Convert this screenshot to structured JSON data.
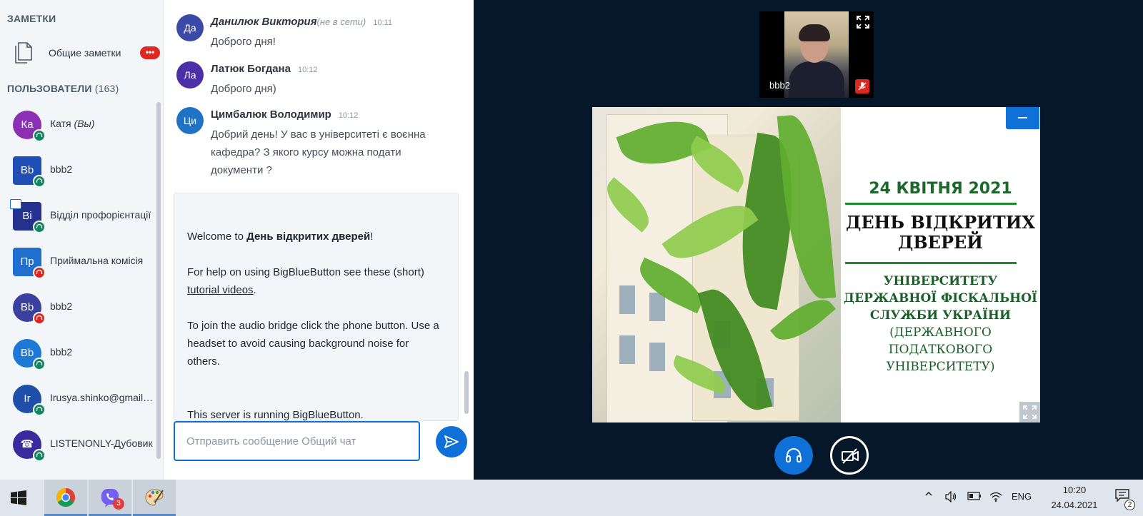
{
  "sidebar": {
    "notes_title": "ЗАМЕТКИ",
    "shared_notes_label": "Общие заметки",
    "shared_notes_badge": "•••",
    "users_title": "ПОЛЬЗОВАТЕЛИ",
    "users_count": "(163)",
    "users": [
      {
        "initials": "Ка",
        "name": "Катя",
        "you_tag": "(Вы)",
        "avatar_color": "#8b2fb3",
        "shape": "circle",
        "status": "listen"
      },
      {
        "initials": "Bb",
        "name": "bbb2",
        "you_tag": "",
        "avatar_color": "#1f4fb4",
        "shape": "square",
        "status": "listen"
      },
      {
        "initials": "Bi",
        "name": "Відділ профорієнтації",
        "you_tag": "",
        "avatar_color": "#24318f",
        "shape": "square",
        "status": "listen",
        "presenter": true
      },
      {
        "initials": "Пр",
        "name": "Приймальна комісія",
        "you_tag": "",
        "avatar_color": "#1f6fd0",
        "shape": "square",
        "status": "muted"
      },
      {
        "initials": "Bb",
        "name": "bbb2",
        "you_tag": "",
        "avatar_color": "#3b3fa0",
        "shape": "circle",
        "status": "muted"
      },
      {
        "initials": "Bb",
        "name": "bbb2",
        "you_tag": "",
        "avatar_color": "#1e78d6",
        "shape": "circle",
        "status": "listen"
      },
      {
        "initials": "Ir",
        "name": "Irusya.shinko@gmail.com",
        "you_tag": "",
        "avatar_color": "#1f4fa8",
        "shape": "circle",
        "status": "listen"
      },
      {
        "initials": "☎",
        "name": "LISTENONLY-Дубовик",
        "you_tag": "",
        "avatar_color": "#3b2a9e",
        "shape": "circle",
        "status": "listen"
      }
    ]
  },
  "chat": {
    "messages": [
      {
        "initials": "Да",
        "avatar_color": "#3a4aa6",
        "name": "Данилюк Виктория",
        "offline_tag": "(не в сети)",
        "time": "10:11",
        "text": "Доброго дня!"
      },
      {
        "initials": "Ла",
        "avatar_color": "#4a2fa8",
        "name": "Латюк Богдана",
        "offline_tag": "",
        "time": "10:12",
        "text": "Доброго дня)"
      },
      {
        "initials": "Ци",
        "avatar_color": "#1f72c4",
        "name": "Цимбалюк Володимир",
        "offline_tag": "",
        "time": "10:12",
        "text": "Добрий день! У вас в університеті є воєнна кафедра? З якого курсу можна подати документи ?"
      }
    ],
    "welcome": {
      "prefix": "Welcome to ",
      "meeting_name": "День відкритих дверей",
      "suffix": "!",
      "help_prefix": "For help on using BigBlueButton see these (short) ",
      "help_link": "tutorial videos",
      "help_suffix": ".",
      "audio_tip": "To join the audio bridge click the phone button. Use a headset to avoid causing background noise for others.",
      "server_note": "This server is running BigBlueButton."
    },
    "input_placeholder": "Отправить сообщение Общий чат"
  },
  "webcam": {
    "name": "bbb2"
  },
  "slide": {
    "date": "24 КВІТНЯ 2021",
    "event_line1": "ДЕНЬ  ВІДКРИТИХ",
    "event_line2": "ДВЕРЕЙ",
    "uni_line1": "УНІВЕРСИТЕТУ",
    "uni_line2": "ДЕРЖАВНОЇ ФІСКАЛЬНОЇ",
    "uni_line3": "СЛУЖБИ УКРАЇНИ",
    "uni_line4": "(ДЕРЖАВНОГО",
    "uni_line5": "ПОДАТКОВОГО",
    "uni_line6": "УНІВЕРСИТЕТУ)"
  },
  "taskbar": {
    "viber_badge": "3",
    "language": "ENG",
    "time": "10:20",
    "date": "24.04.2021",
    "notifications": "2"
  },
  "colors": {
    "primary": "#0f70d7",
    "danger": "#df2721",
    "success": "#11855f",
    "dark_bg": "#06172a"
  }
}
